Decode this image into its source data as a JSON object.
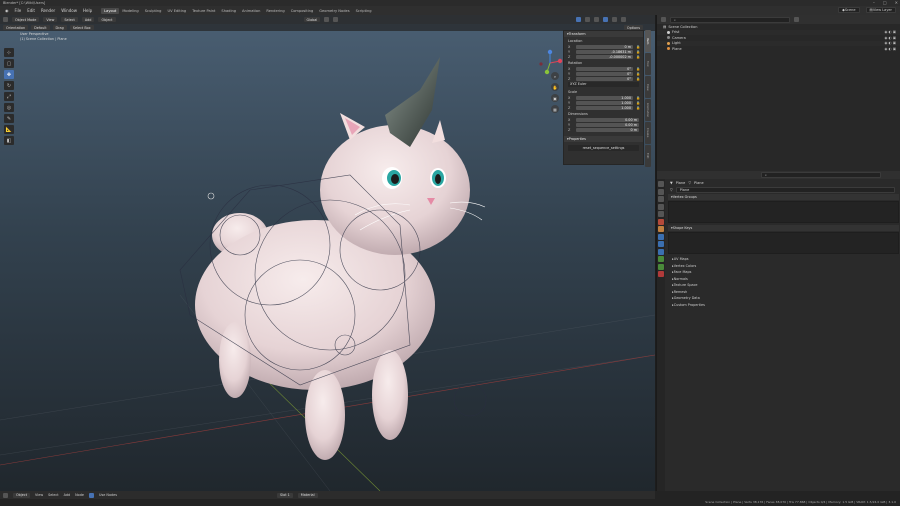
{
  "window": {
    "title": "Blender* [C:\\Wiki\\Users]"
  },
  "menu": {
    "items": [
      "File",
      "Edit",
      "Render",
      "Window",
      "Help"
    ],
    "workspaces": [
      "Layout",
      "Modeling",
      "Sculpting",
      "UV Editing",
      "Texture Paint",
      "Shading",
      "Animation",
      "Rendering",
      "Compositing",
      "Geometry Nodes",
      "Scripting"
    ],
    "active_workspace": "Layout",
    "scene": "Scene",
    "view_layer": "View Layer"
  },
  "viewport": {
    "mode": "Object Mode",
    "menus": [
      "View",
      "Select",
      "Add",
      "Object"
    ],
    "transform": "Global",
    "orientation": "Orientation",
    "pivot": "Default",
    "drag": "Drag",
    "select_box": "Select Box",
    "options": "Options",
    "info_line1": "User Perspective",
    "info_line2": "(1) Scene Collection | Plane"
  },
  "npanel": {
    "transform_header": "Transform",
    "location_label": "Location",
    "location": [
      {
        "axis": "X",
        "value": "0 m"
      },
      {
        "axis": "Y",
        "value": "-0.18631 m"
      },
      {
        "axis": "Z",
        "value": "-0.000002 m"
      }
    ],
    "rotation_label": "Rotation",
    "rotation": [
      {
        "axis": "X",
        "value": "0°"
      },
      {
        "axis": "Y",
        "value": "0°"
      },
      {
        "axis": "Z",
        "value": "0°"
      }
    ],
    "rotation_mode": "XYZ Euler",
    "scale_label": "Scale",
    "scale": [
      {
        "axis": "X",
        "value": "1.000"
      },
      {
        "axis": "Y",
        "value": "1.000"
      },
      {
        "axis": "Z",
        "value": "1.000"
      }
    ],
    "dimensions_label": "Dimensions",
    "dimensions": [
      {
        "axis": "X",
        "value": "0.00 m"
      },
      {
        "axis": "Y",
        "value": "0.00 m"
      },
      {
        "axis": "Z",
        "value": "0 m"
      }
    ],
    "properties_header": "Properties",
    "operator_label": "reset_sequence_settings",
    "tabs": [
      "Item",
      "Tool",
      "View",
      "Animation",
      "Create",
      "Edit"
    ]
  },
  "outliner": {
    "root": "Scene Collection",
    "rows": [
      {
        "name": "Frist",
        "color": "#d0d0d0"
      },
      {
        "name": "Camera",
        "color": "#8a8a8a"
      },
      {
        "name": "Light",
        "color": "#e0a050"
      },
      {
        "name": "Plane",
        "color": "#e09040"
      }
    ]
  },
  "properties": {
    "breadcrumb_object": "Plane",
    "breadcrumb_data": "Plane",
    "data_name": "Plane",
    "sections": {
      "vertex_groups": "Vertex Groups",
      "shape_keys": "Shape Keys"
    },
    "subpanels": [
      "UV Maps",
      "Vertex Colors",
      "Face Maps",
      "Normals",
      "Texture Space",
      "Remesh",
      "Geometry Data",
      "Custom Properties"
    ]
  },
  "footer": {
    "items": [
      "Object",
      "View",
      "Select",
      "Add",
      "Node"
    ],
    "use_nodes": "Use Nodes",
    "slot": "Slot 1",
    "material": "Material"
  },
  "status": {
    "text": "Scene Collection | Plane | Verts 38,176 | Faces 38,070 | Tris 77,868 | Objects 0/4 | Memory: 1.5 GiB | VRAM: 1.5/24.0 GiB | 3.1.0"
  },
  "colors": {
    "accent": "#4772b3",
    "viewport_top": "#4a5f73",
    "viewport_bottom": "#20272d"
  }
}
